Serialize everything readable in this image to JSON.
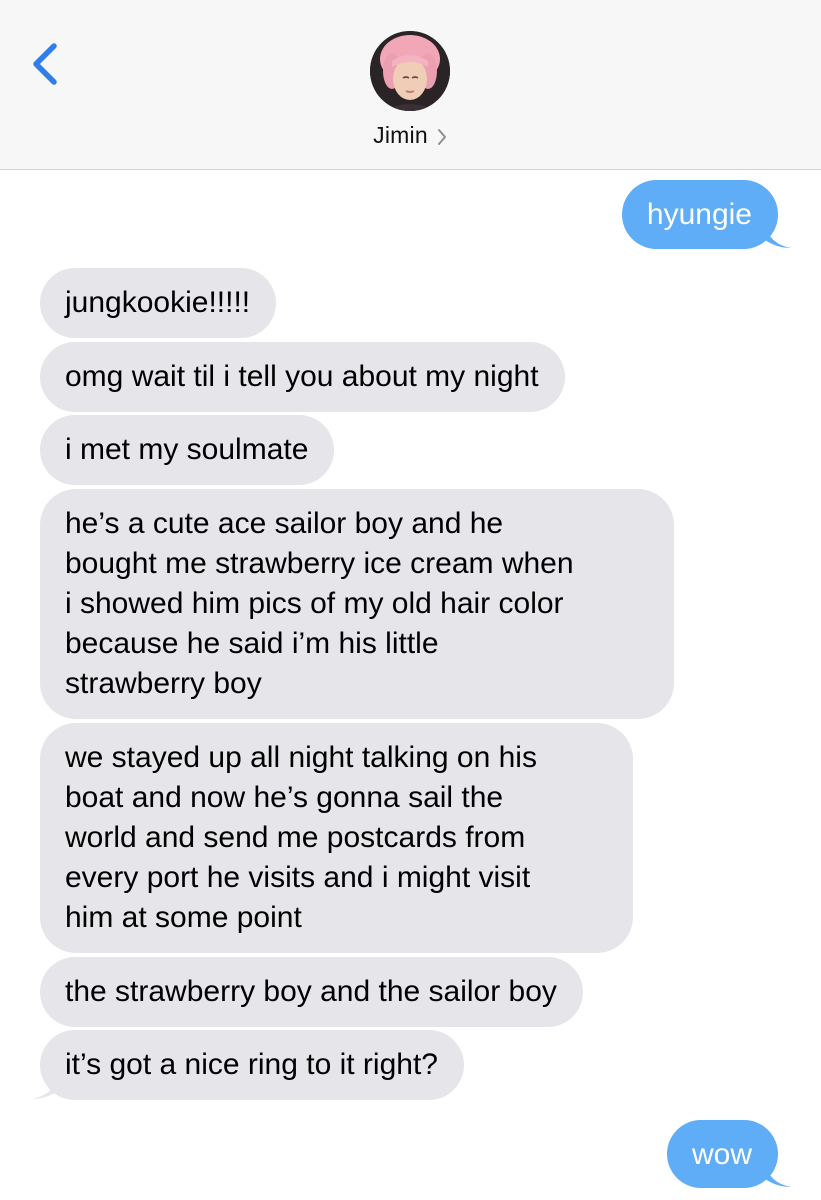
{
  "header": {
    "back_icon": "chevron-left-icon",
    "contact_name": "Jimin",
    "details_icon": "chevron-right-icon"
  },
  "colors": {
    "incoming_bubble": "#e5e5ea",
    "outgoing_bubble": "#5eadf6",
    "ios_blue": "#2f80ed",
    "header_bg": "#f7f7f7"
  },
  "messages": [
    {
      "from": "me",
      "text": "hyungie"
    },
    {
      "from": "contact",
      "text": "jungkookie!!!!!"
    },
    {
      "from": "contact",
      "text": "omg wait til i tell you about my night"
    },
    {
      "from": "contact",
      "text": "i met my soulmate"
    },
    {
      "from": "contact",
      "text": "he’s a cute ace sailor boy and he\nbought me strawberry ice cream when\ni showed him pics of my old hair color\nbecause he said i’m his little\nstrawberry boy"
    },
    {
      "from": "contact",
      "text": "we stayed up all night talking on his\nboat and now he’s gonna sail the\nworld and send me postcards from\nevery port he visits and i might visit\nhim at some point"
    },
    {
      "from": "contact",
      "text": "the strawberry boy and the sailor boy"
    },
    {
      "from": "contact",
      "text": "it’s got a nice ring to it right?"
    },
    {
      "from": "me",
      "text": "wow"
    }
  ]
}
